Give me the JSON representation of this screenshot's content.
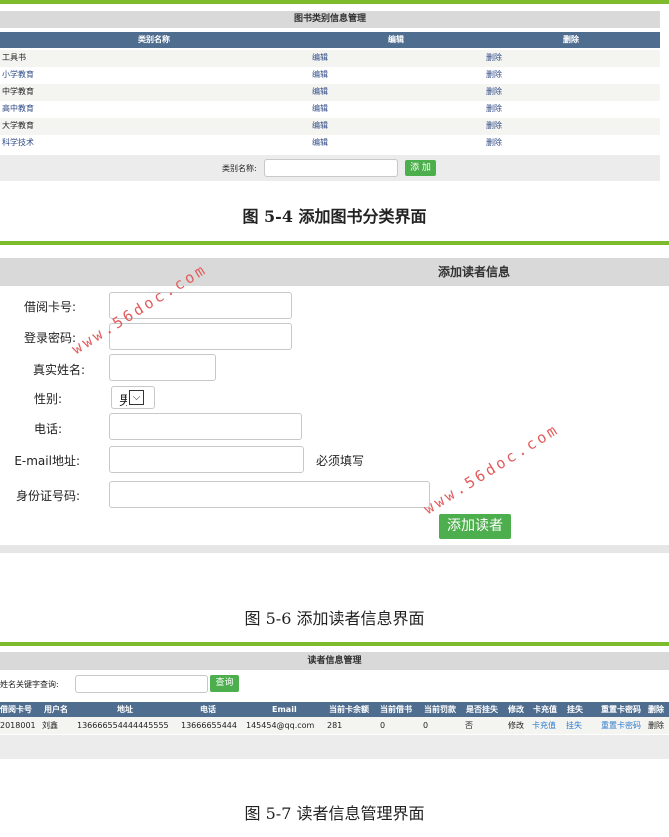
{
  "category_section": {
    "title": "图书类别信息管理",
    "columns": [
      "类别名称",
      "编辑",
      "删除"
    ],
    "rows": [
      {
        "name": "工具书",
        "edit": "编辑",
        "delete": "删除"
      },
      {
        "name": "小学教育",
        "edit": "编辑",
        "delete": "删除"
      },
      {
        "name": "中学教育",
        "edit": "编辑",
        "delete": "删除"
      },
      {
        "name": "高中教育",
        "edit": "编辑",
        "delete": "删除"
      },
      {
        "name": "大学教育",
        "edit": "编辑",
        "delete": "删除"
      },
      {
        "name": "科学技术",
        "edit": "编辑",
        "delete": "删除"
      }
    ],
    "form_label": "类别名称:",
    "input_value": "",
    "add_button": "添 加",
    "caption": "图 5-4 添加图书分类界面"
  },
  "reader_add_section": {
    "title": "添加读者信息",
    "labels": {
      "card_no": "借阅卡号:",
      "password": "登录密码:",
      "real_name": "真实姓名:",
      "gender": "性别:",
      "phone": "电话:",
      "email": "E-mail地址:",
      "id_card": "身份证号码:"
    },
    "gender_value": "男",
    "required_note": "必须填写",
    "submit_button": "添加读者",
    "caption": "图 5-6 添加读者信息界面"
  },
  "reader_manage_section": {
    "title": "读者信息管理",
    "search_label": "按姓名关键字查询:",
    "search_value": "",
    "search_button": "查询",
    "columns": [
      "借阅卡号",
      "用户名",
      "地址",
      "电话",
      "Email",
      "当前卡余额",
      "当前借书",
      "当前罚款",
      "是否挂失",
      "修改",
      "卡充值",
      "挂失",
      "重置卡密码",
      "删除"
    ],
    "rows": [
      {
        "card_no": "2018001",
        "username": "刘鑫",
        "address": "136666554444445555",
        "phone": "13666655444",
        "email": "145454@qq.com",
        "balance": "281",
        "borrowed": "0",
        "fine": "0",
        "lost": "否",
        "edit": "修改",
        "recharge": "卡充值",
        "report_lost": "挂失",
        "reset_pwd": "重置卡密码",
        "delete": "删除"
      }
    ],
    "caption": "图 5-7 读者信息管理界面"
  },
  "watermark": "www.56doc.com",
  "colors": {
    "accent_green": "#7dbb2c",
    "header_blue": "#4f6d8f",
    "button_green": "#4cae4c",
    "link_blue": "#2e7bcf"
  }
}
